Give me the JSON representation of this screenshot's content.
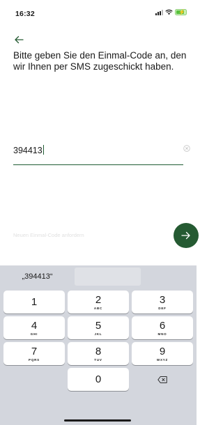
{
  "status_bar": {
    "time": "16:32",
    "icons": [
      "signal-icon",
      "wifi-icon",
      "battery-charging-icon"
    ],
    "battery_color": "#57c13e"
  },
  "back_icon": "arrow-left-icon",
  "instruction": "Bitte geben Sie den Einmal-Code an, den wir Ihnen per SMS zugeschickt haben.",
  "code_input": {
    "value": "394413",
    "clear_icon": "clear-circle-icon"
  },
  "resend_link": "Neuen Einmal-Code anfordern",
  "submit_icon": "arrow-right-icon",
  "accent_color": "#255a32",
  "keyboard": {
    "suggestion": "„394413“",
    "keys": [
      {
        "digit": "1",
        "letters": ""
      },
      {
        "digit": "2",
        "letters": "ABC"
      },
      {
        "digit": "3",
        "letters": "DEF"
      },
      {
        "digit": "4",
        "letters": "GHI"
      },
      {
        "digit": "5",
        "letters": "JKL"
      },
      {
        "digit": "6",
        "letters": "MNO"
      },
      {
        "digit": "7",
        "letters": "PQRS"
      },
      {
        "digit": "8",
        "letters": "TUV"
      },
      {
        "digit": "9",
        "letters": "WXYZ"
      },
      {
        "digit": "0",
        "letters": ""
      }
    ],
    "delete_icon": "backspace-icon"
  }
}
